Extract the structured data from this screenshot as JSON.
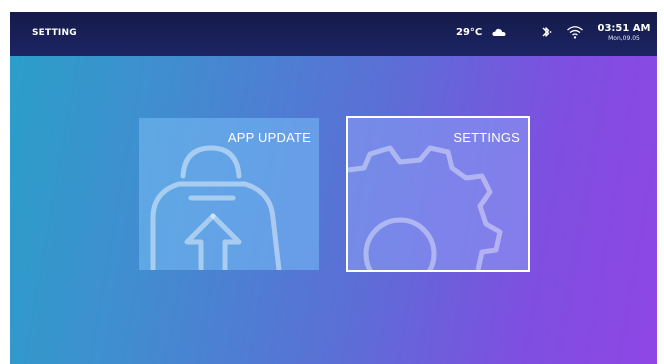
{
  "statusbar": {
    "title": "SETTING",
    "temperature": "29°C",
    "weather_icon": "cloud-icon",
    "bluetooth_icon": "bluetooth-icon",
    "wifi_icon": "wifi-icon",
    "time": "03:51 AM",
    "date": "Mon,09.05"
  },
  "tiles": [
    {
      "label": "APP UPDATE",
      "icon": "app-update-icon",
      "selected": false
    },
    {
      "label": "SETTINGS",
      "icon": "gear-icon",
      "selected": true
    }
  ],
  "colors": {
    "statusbar_bg": "#1a215a",
    "gradient_start": "#2a9fc9",
    "gradient_end": "#8f46e4",
    "selection_border": "#ffffff"
  }
}
